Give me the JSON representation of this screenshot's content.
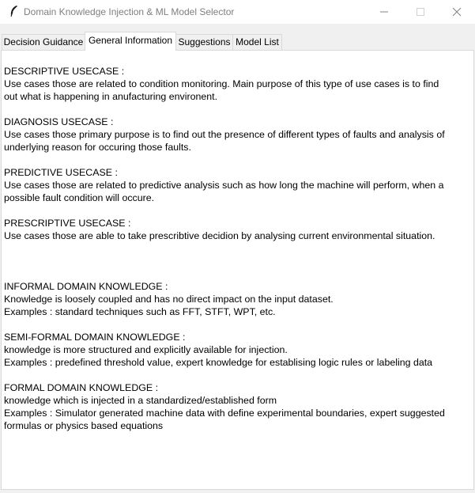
{
  "window": {
    "title": "Domain Knowledge Injection & ML Model Selector"
  },
  "tabs": [
    {
      "label": "Decision Guidance",
      "active": false
    },
    {
      "label": "General Information",
      "active": true
    },
    {
      "label": "Suggestions",
      "active": false
    },
    {
      "label": "Model List",
      "active": false
    }
  ],
  "content": {
    "usecases": [
      {
        "heading": "DESCRIPTIVE USECASE :",
        "lines": [
          "Use cases those are related to condition monitoring. Main purpose of this type of use cases is to find",
          "out what is happening in anufacturing environent."
        ]
      },
      {
        "heading": "DIAGNOSIS USECASE :",
        "lines": [
          "Use cases those primary purpose is to find out the presence of different types of faults and analysis of",
          "underlying reason for occuring those faults."
        ]
      },
      {
        "heading": "PREDICTIVE USECASE :",
        "lines": [
          "Use cases those are related to predictive analysis such as how long the machine will perform, when a",
          "possible fault condition will occure."
        ]
      },
      {
        "heading": "PRESCRIPTIVE USECASE :",
        "lines": [
          "Use cases those are able to take prescribtive decidion by analysing current environmental situation."
        ]
      }
    ],
    "knowledge": [
      {
        "heading": "INFORMAL DOMAIN KNOWLEDGE :",
        "lines": [
          "Knowledge is loosely coupled and has no direct impact on the input dataset.",
          "Examples : standard techniques such as FFT, STFT, WPT, etc."
        ]
      },
      {
        "heading": "SEMI-FORMAL DOMAIN KNOWLEDGE :",
        "lines": [
          "knowledge is more structured and explicitly available for injection.",
          "Examples : predefined threshold value, expert knowledge for establising logic rules or labeling data"
        ]
      },
      {
        "heading": "FORMAL DOMAIN KNOWLEDGE :",
        "lines": [
          "knowledge which is injected in a standardized/established form",
          "Examples : Simulator generated machine data with define experimental boundaries, expert suggested",
          "formulas or physics based equations"
        ]
      }
    ]
  }
}
